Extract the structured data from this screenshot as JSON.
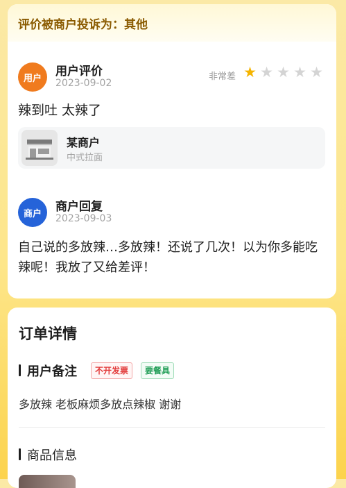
{
  "complaint": {
    "text": "评价被商户投诉为：其他"
  },
  "user_review": {
    "avatar_label": "用户",
    "title": "用户评价",
    "date": "2023-09-02",
    "rating_label": "非常差",
    "rating": 1,
    "rating_max": 5,
    "content": "辣到吐 太辣了"
  },
  "shop": {
    "name": "某商户",
    "category": "中式拉面",
    "icon": "storefront-icon"
  },
  "merchant_reply": {
    "avatar_label": "商户",
    "title": "商户回复",
    "date": "2023-09-03",
    "content": "自己说的多放辣…多放辣！还说了几次！以为你多能吃辣呢！我放了又给差评！"
  },
  "order": {
    "title": "订单详情",
    "remark_section": "用户备注",
    "tags": [
      "不开发票",
      "要餐具"
    ],
    "remark": "多放辣 老板麻烦多放点辣椒 谢谢",
    "goods_section": "商品信息"
  },
  "colors": {
    "user_avatar": "#f07b1e",
    "merchant_avatar": "#2563d9",
    "star_on": "#f5b400",
    "star_off": "#d4d4d4"
  }
}
